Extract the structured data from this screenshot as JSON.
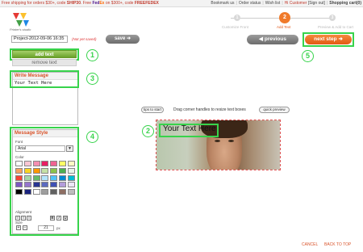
{
  "topbar": {
    "promo_prefix": "Free shipping for orders $30+, code ",
    "promo_code1": "SHIP30",
    "promo_mid": ". Free ",
    "fedex_fe": "Fed",
    "fedex_ex": "Ex",
    "promo_suffix": " on $300+, code ",
    "promo_code2": "FREEFEDEX",
    "links": [
      "Bookmark us",
      "Order status",
      "Wish list"
    ],
    "customer": "Hi Customer",
    "signout": "[Sign out]",
    "cart": "Shopping cart(0)"
  },
  "logo": {
    "text": "Printer's studio"
  },
  "steps": [
    {
      "num": "1",
      "label": "Customize Front",
      "active": false
    },
    {
      "num": "2",
      "label": "Add Text",
      "active": true
    },
    {
      "num": "3",
      "label": "Preview & Add to Cart",
      "active": false
    }
  ],
  "project": {
    "name": "Project-2012-09-06 16:35",
    "status": "(Not yet saved)",
    "save_label": "save"
  },
  "nav": {
    "previous_label": "previous",
    "next_label": "next step"
  },
  "text_tools": {
    "add_label": "add text",
    "remove_label": "remove text"
  },
  "write_message": {
    "title": "Write Message",
    "value": "Your Text Here"
  },
  "message_style": {
    "title": "Message Style",
    "font_label": "Font",
    "font_value": "Arial",
    "color_label": "Color",
    "alignment_label": "Alignment",
    "size_label": "Size",
    "size_value": "21",
    "size_unit": "px",
    "bold": "B",
    "italic": "I",
    "underline": "U"
  },
  "colors": [
    "#ffffff",
    "#f9c6d3",
    "#f48fb1",
    "#e91e63",
    "#f06292",
    "#ffff66",
    "#fff9c4",
    "#f4a261",
    "#f9d423",
    "#ff9800",
    "#c5e1a5",
    "#8bc34a",
    "#4caf50",
    "#e8f5e9",
    "#f44336",
    "#a5d6a7",
    "#66bb6a",
    "#b3e5fc",
    "#4fc3f7",
    "#0288d1",
    "#00bcd4",
    "#7e57c2",
    "#9575cd",
    "#283593",
    "#5c6bc0",
    "#3f51b5",
    "#b39ddb",
    "#ede7f6",
    "#000000",
    "#1a237e",
    "#ffffff",
    "#9e9e9e",
    "#616161",
    "#8d6e63",
    "#bdbdbd"
  ],
  "canvas": {
    "tips_label": "tips to start",
    "hint": "Drag corner handles to resize text boxes",
    "preview_label": "quick preview",
    "overlay_text": "Your Text Here"
  },
  "footer": {
    "cancel": "CANCEL",
    "back_to_top": "BACK TO TOP"
  },
  "callouts": [
    "1",
    "2",
    "3",
    "4",
    "5"
  ]
}
